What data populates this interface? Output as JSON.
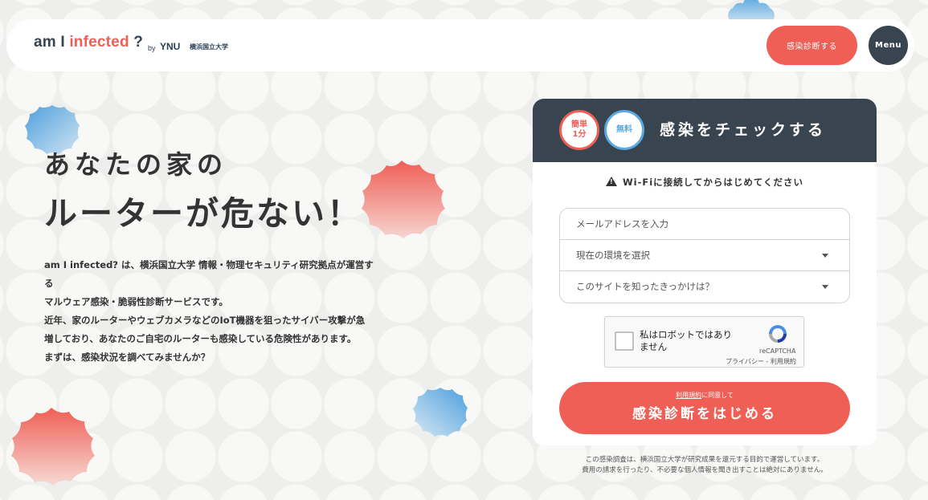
{
  "header": {
    "logo": {
      "part1": "am I ",
      "part2": "infected",
      "part3": " ?",
      "by": "by",
      "ynu": "YNU",
      "university": "横浜国立大学"
    },
    "cta_label": "感染診断する",
    "menu_label": "Menu"
  },
  "hero": {
    "line1": "あなたの家の",
    "line2": "ルーターが危ない！",
    "description": [
      "am I infected? は、横浜国立大学 情報・物理セキュリティ研究拠点が運営する",
      "マルウェア感染・脆弱性診断サービスです。",
      "近年、家のルーターやウェブカメラなどのIoT機器を狙ったサイバー攻撃が急",
      "増しており、あなたのご自宅のルーターも感染している危険性があります。",
      "まずは、感染状況を調べてみませんか？"
    ]
  },
  "card": {
    "badge_easy_line1": "簡単",
    "badge_easy_line2": "1分",
    "badge_free": "無料",
    "title": "感染をチェックする",
    "notice": "Wi-Fiに接続してからはじめてください",
    "fields": {
      "email_placeholder": "メールアドレスを入力",
      "environment_placeholder": "現在の環境を選択",
      "referral_placeholder": "このサイトを知ったきっかけは？"
    },
    "captcha": {
      "label": "私はロボットではありません",
      "brand": "reCAPTCHA",
      "privacy": "プライバシー",
      "separator": " - ",
      "terms": "利用規約"
    },
    "submit": {
      "terms_link": "利用規約",
      "agree_suffix": "に同意して",
      "label": "感染診断をはじめる"
    }
  },
  "footnote": [
    "この感染調査は、横浜国立大学が研究成果を還元する目的で運営しています。",
    "費用の請求を行ったり、不必要な個人情報を聞き出すことは絶対にありません。"
  ],
  "colors": {
    "accent": "#ef5f55",
    "navy": "#38444f",
    "blue": "#5aa9e0",
    "background": "#eeeeec"
  }
}
